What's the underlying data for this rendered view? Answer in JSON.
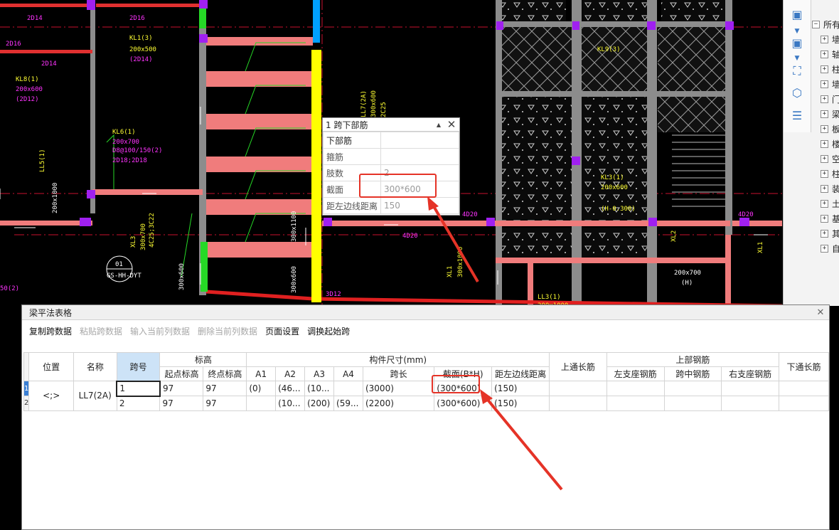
{
  "cad": {
    "labels": [
      {
        "text": "2D14",
        "color": "#ff33ff"
      },
      {
        "text": "2D16",
        "color": "#ff33ff"
      },
      {
        "text": "2D16",
        "color": "#ff33ff"
      },
      {
        "text": "2D14",
        "color": "#ff33ff"
      },
      {
        "text": "KL8(1)",
        "color": "#ffff33"
      },
      {
        "text": "200x600",
        "color": "#ff33ff"
      },
      {
        "text": "(2D12)",
        "color": "#ff33ff"
      },
      {
        "text": "KL1(3)",
        "color": "#ffff33"
      },
      {
        "text": "200x500",
        "color": "#ffff33"
      },
      {
        "text": "(2D14)",
        "color": "#ff33ff"
      },
      {
        "text": "KL6(1)",
        "color": "#ffff33"
      },
      {
        "text": "200x700",
        "color": "#ff33ff"
      },
      {
        "text": "D8@100/150(2)",
        "color": "#ff33ff"
      },
      {
        "text": "2D18;2D18",
        "color": "#ff33ff"
      },
      {
        "text": "LL5(1)",
        "color": "#ffff33"
      },
      {
        "text": "200x1000",
        "color": "#ffffff"
      },
      {
        "text": "XL3",
        "color": "#ffff33"
      },
      {
        "text": "300x700",
        "color": "#ffff33"
      },
      {
        "text": "4C25;3C22",
        "color": "#ffff33"
      },
      {
        "text": "300x600",
        "color": "#ffffff"
      },
      {
        "text": "300x1100",
        "color": "#ffffff"
      },
      {
        "text": "300x600",
        "color": "#ffffff"
      },
      {
        "text": "3D12",
        "color": "#ff33ff"
      },
      {
        "text": "01",
        "color": "#ffffff"
      },
      {
        "text": "GS-HH-DYT",
        "color": "#ffffff"
      },
      {
        "text": "LL7(2A)",
        "color": "#ffff33"
      },
      {
        "text": "300x600",
        "color": "#ffff33"
      },
      {
        "text": "2C25",
        "color": "#ffff33"
      },
      {
        "text": "4D20",
        "color": "#ff33ff"
      },
      {
        "text": "4D20",
        "color": "#ff33ff"
      },
      {
        "text": "KL9(3)",
        "color": "#ffff33"
      },
      {
        "text": "KL3(1)",
        "color": "#ffff33"
      },
      {
        "text": "200x600",
        "color": "#ffff33"
      },
      {
        "text": "(H-0.300)",
        "color": "#ffff33"
      },
      {
        "text": "LL3(1)",
        "color": "#ffff33"
      },
      {
        "text": "200x1000",
        "color": "#ffff33"
      },
      {
        "text": "XL1",
        "color": "#ffff33"
      },
      {
        "text": "300x1000",
        "color": "#ffff33"
      },
      {
        "text": "XL2",
        "color": "#ffff33"
      },
      {
        "text": "200x700",
        "color": "#ffffff"
      },
      {
        "text": "(H)",
        "color": "#ffffff"
      },
      {
        "text": "4D20",
        "color": "#ff33ff"
      },
      {
        "text": "XL1",
        "color": "#ffff33"
      },
      {
        "text": "50(2)",
        "color": "#ff33ff"
      }
    ]
  },
  "right_panel": {
    "tools": [
      "cube-icon",
      "dropdown-arrow-icon",
      "cube-icon",
      "dropdown-arrow-icon",
      "fullscreen-icon",
      "box-icon",
      "list-icon"
    ],
    "tree": [
      "所有",
      "墙",
      "轴",
      "柱",
      "墙",
      "门",
      "梁",
      "板",
      "楼",
      "空",
      "柱",
      "装",
      "土",
      "基",
      "其",
      "自"
    ]
  },
  "float_dialog": {
    "title": "1 跨下部筋",
    "rows": [
      {
        "key": "下部筋",
        "value": ""
      },
      {
        "key": "箍筋",
        "value": ""
      },
      {
        "key": "肢数",
        "value": "2"
      },
      {
        "key": "截面",
        "value": "300*600"
      },
      {
        "key": "距左边线距离",
        "value": "150"
      }
    ]
  },
  "window": {
    "title": "梁平法表格",
    "toolbar": [
      {
        "label": "复制跨数据",
        "enabled": true
      },
      {
        "label": "粘贴跨数据",
        "enabled": false
      },
      {
        "label": "输入当前列数据",
        "enabled": false
      },
      {
        "label": "删除当前列数据",
        "enabled": false
      },
      {
        "label": "页面设置",
        "enabled": true
      },
      {
        "label": "调换起始跨",
        "enabled": true
      }
    ],
    "headers": {
      "position": "位置",
      "name": "名称",
      "span": "跨号",
      "elevation_group": "标高",
      "start_elev": "起点标高",
      "end_elev": "终点标高",
      "size_group": "构件尺寸(mm)",
      "a1": "A1",
      "a2": "A2",
      "a3": "A3",
      "a4": "A4",
      "span_len": "跨长",
      "section": "截面(B*H)",
      "dist_left": "距左边线距离",
      "top_through": "上通长筋",
      "top_group": "上部钢筋",
      "left_support": "左支座钢筋",
      "mid_span": "跨中钢筋",
      "right_support": "右支座钢筋",
      "bottom_through": "下通长筋"
    },
    "position_value": "<;>",
    "name_value": "LL7(2A)",
    "rows": [
      {
        "index": "1",
        "span": "1",
        "start": "97",
        "end": "97",
        "a1": "(0)",
        "a2": "(46...",
        "a3": "(10...",
        "a4": "",
        "span_len": "(3000)",
        "section": "(300*600)",
        "dist": "(150)"
      },
      {
        "index": "2",
        "span": "2",
        "start": "97",
        "end": "97",
        "a1": "",
        "a2": "(10...",
        "a3": "(200)",
        "a4": "(59...",
        "span_len": "(2200)",
        "section": "(300*600)",
        "dist": "(150)"
      }
    ]
  },
  "colors": {
    "highlight": "#e53327",
    "cad_bg": "#000000",
    "beam": "#f07c7c",
    "column": "#8c8c8c",
    "selection": "#ffff00"
  }
}
